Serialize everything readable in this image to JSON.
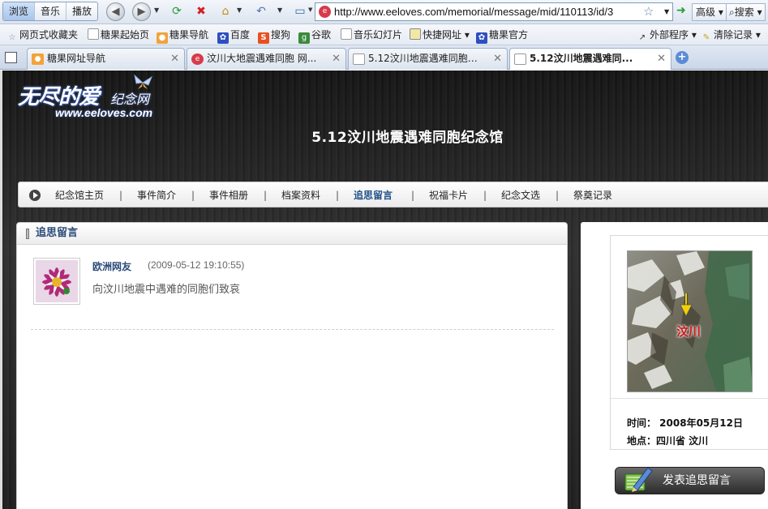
{
  "browser": {
    "mode_tabs": [
      "浏览",
      "音乐",
      "播放"
    ],
    "address_url": "http://www.eeloves.com/memorial/message/mid/110113/id/3",
    "advanced_label": "高级",
    "search_label": "搜索",
    "bookmarks": [
      "网页式收藏夹",
      "糖果起始页",
      "糖果导航",
      "百度",
      "搜狗",
      "谷歌",
      "音乐幻灯片",
      "快捷网址",
      "糖果官方"
    ],
    "bookmark_right": [
      "外部程序",
      "清除记录"
    ],
    "tabs": [
      {
        "title": "糖果网址导航"
      },
      {
        "title": "汶川大地震遇难同胞 网..."
      },
      {
        "title": "5.12汶川地震遇难同胞纪..."
      },
      {
        "title": "5.12汶川地震遇难同..."
      }
    ]
  },
  "site": {
    "logo_main": "无尽的爱",
    "logo_sub": "纪念网",
    "logo_url": "www.eeloves.com",
    "hall_title": "5.12汶川地震遇难同胞纪念馆",
    "nav": [
      "纪念馆主页",
      "事件简介",
      "事件相册",
      "档案资料",
      "追思留言",
      "祝福卡片",
      "纪念文选",
      "祭奠记录"
    ],
    "nav_current": "追思留言"
  },
  "messages_section": {
    "title": "追思留言",
    "items": [
      {
        "author": "欧洲网友",
        "date": "(2009-05-12 19:10:55)",
        "text": "向汶川地震中遇难的同胞们致哀"
      }
    ]
  },
  "event_info": {
    "map_label": "汶川",
    "time_line": "时间：  2008年05月12日",
    "place_line": "地点：四川省 汶川",
    "post_button": "发表追思留言"
  },
  "colors": {
    "accent_blue": "#2b4b7a",
    "map_label_red": "#d01818",
    "page_dark": "#1f1f1f"
  }
}
